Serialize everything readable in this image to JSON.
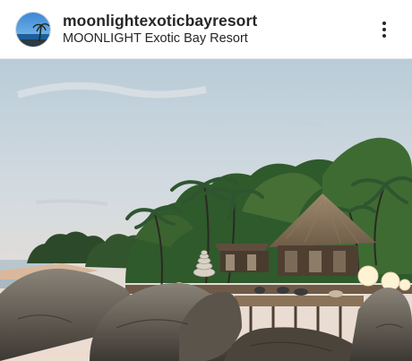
{
  "post": {
    "username": "moonlightexoticbayresort",
    "location": "MOONLIGHT Exotic Bay Resort",
    "avatar_icon": "profile-avatar-beach-icon",
    "more_icon": "more-options-vertical-dots-icon"
  }
}
